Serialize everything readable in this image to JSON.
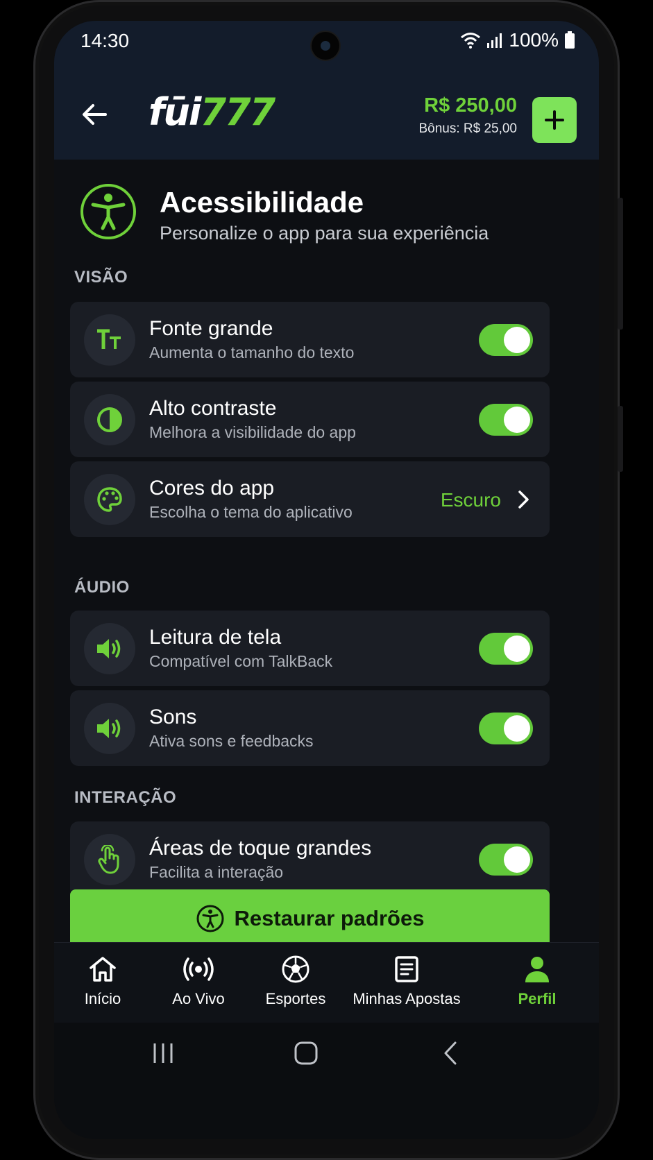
{
  "status": {
    "time": "14:30",
    "battery": "100%"
  },
  "header": {
    "logo_main": "fūi",
    "logo_num": "777",
    "balance": "R$ 250,00",
    "bonus": "Bônus: R$ 25,00"
  },
  "page": {
    "title": "Acessibilidade",
    "subtitle": "Personalize o app para sua experiência"
  },
  "sections": {
    "vision": "VISÃO",
    "audio": "ÁUDIO",
    "interaction": "INTERAÇÃO"
  },
  "settings": [
    {
      "title": "Fonte grande",
      "subtitle": "Aumenta o tamanho do texto",
      "icon": "text-size-icon",
      "enabled": true
    },
    {
      "title": "Alto contraste",
      "subtitle": "Melhora a visibilidade do app",
      "icon": "contrast-icon",
      "enabled": true
    },
    {
      "title": "Cores do app",
      "subtitle": "Escolha o tema do aplicativo",
      "icon": "palette-icon",
      "value": "Escuro"
    },
    {
      "title": "Leitura de tela",
      "subtitle": "Compatível com TalkBack",
      "icon": "speaker-icon",
      "enabled": true
    },
    {
      "title": "Sons",
      "subtitle": "Ativa sons e feedbacks",
      "icon": "speaker-icon",
      "enabled": true
    },
    {
      "title": "Áreas de toque grandes",
      "subtitle": "Facilita a interação",
      "icon": "touch-hand-icon",
      "enabled": true
    }
  ],
  "restore_button": "Restaurar padrões",
  "tabs": [
    {
      "label": "Início",
      "icon": "home-icon"
    },
    {
      "label": "Ao Vivo",
      "icon": "live-broadcast-icon"
    },
    {
      "label": "Esportes",
      "icon": "soccer-ball-icon"
    },
    {
      "label": "Minhas Apostas",
      "icon": "bet-slip-icon"
    },
    {
      "label": "Perfil",
      "icon": "profile-icon",
      "active": true
    }
  ],
  "colors": {
    "accent": "#6fd13a",
    "background": "#0d0f13",
    "card": "#1a1d24",
    "header": "#131c2b"
  }
}
